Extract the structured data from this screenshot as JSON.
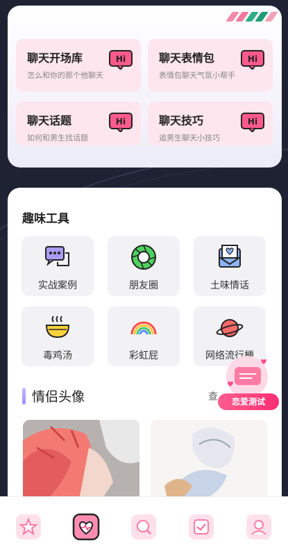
{
  "chat_tools": [
    {
      "title": "聊天开场库",
      "subtitle": "怎么和你的那个他聊天",
      "badge": "Hi"
    },
    {
      "title": "聊天表情包",
      "subtitle": "表情包聊天气氛小帮手",
      "badge": "Hi"
    },
    {
      "title": "聊天话题",
      "subtitle": "如何和男生找话题",
      "badge": "Hi"
    },
    {
      "title": "聊天技巧",
      "subtitle": "追男生聊天小技巧",
      "badge": "Hi"
    }
  ],
  "fun_tools": {
    "title": "趣味工具",
    "items": [
      {
        "label": "实战案例",
        "icon": "chat-bubbles-icon"
      },
      {
        "label": "朋友圈",
        "icon": "aperture-icon"
      },
      {
        "label": "土味情话",
        "icon": "heart-envelope-icon"
      },
      {
        "label": "毒鸡汤",
        "icon": "soup-bowl-icon"
      },
      {
        "label": "彩虹屁",
        "icon": "rainbow-icon"
      },
      {
        "label": "网络流行梗",
        "icon": "planet-icon"
      }
    ]
  },
  "couple_avatars": {
    "title": "情侣头像",
    "more": "查"
  },
  "love_test": {
    "label": "恋爱测试"
  },
  "tabs": [
    {
      "name": "tab-star",
      "active": false
    },
    {
      "name": "tab-heart",
      "active": true
    },
    {
      "name": "tab-search",
      "active": false
    },
    {
      "name": "tab-check",
      "active": false
    },
    {
      "name": "tab-profile",
      "active": false
    }
  ],
  "colors": {
    "accent": "#ff3d7f",
    "card_pink": "#fde6ee",
    "background": "#1f2233"
  }
}
